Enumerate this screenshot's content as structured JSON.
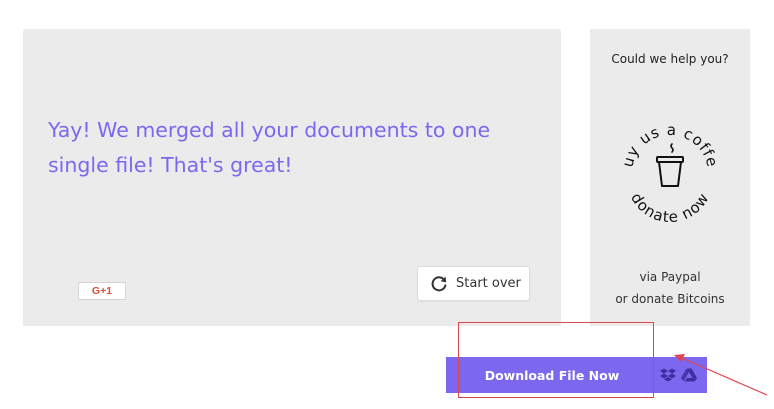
{
  "result": {
    "message": "Yay! We merged all your documents to one single file! That's great!",
    "gplus_label": "G+1",
    "start_over_label": "Start over"
  },
  "sidebar": {
    "title": "Could we help you?",
    "badge_top_text": "buy us a coffee",
    "badge_bottom_text": "donate now",
    "via_paypal": "via Paypal",
    "donate_bitcoins": "or donate Bitcoins"
  },
  "download": {
    "button_label": "Download File Now",
    "icons": [
      "dropbox-icon",
      "google-drive-icon"
    ]
  },
  "colors": {
    "accent": "#7b68ee",
    "panel_bg": "#ebebeb",
    "annotation": "#e0454f"
  }
}
